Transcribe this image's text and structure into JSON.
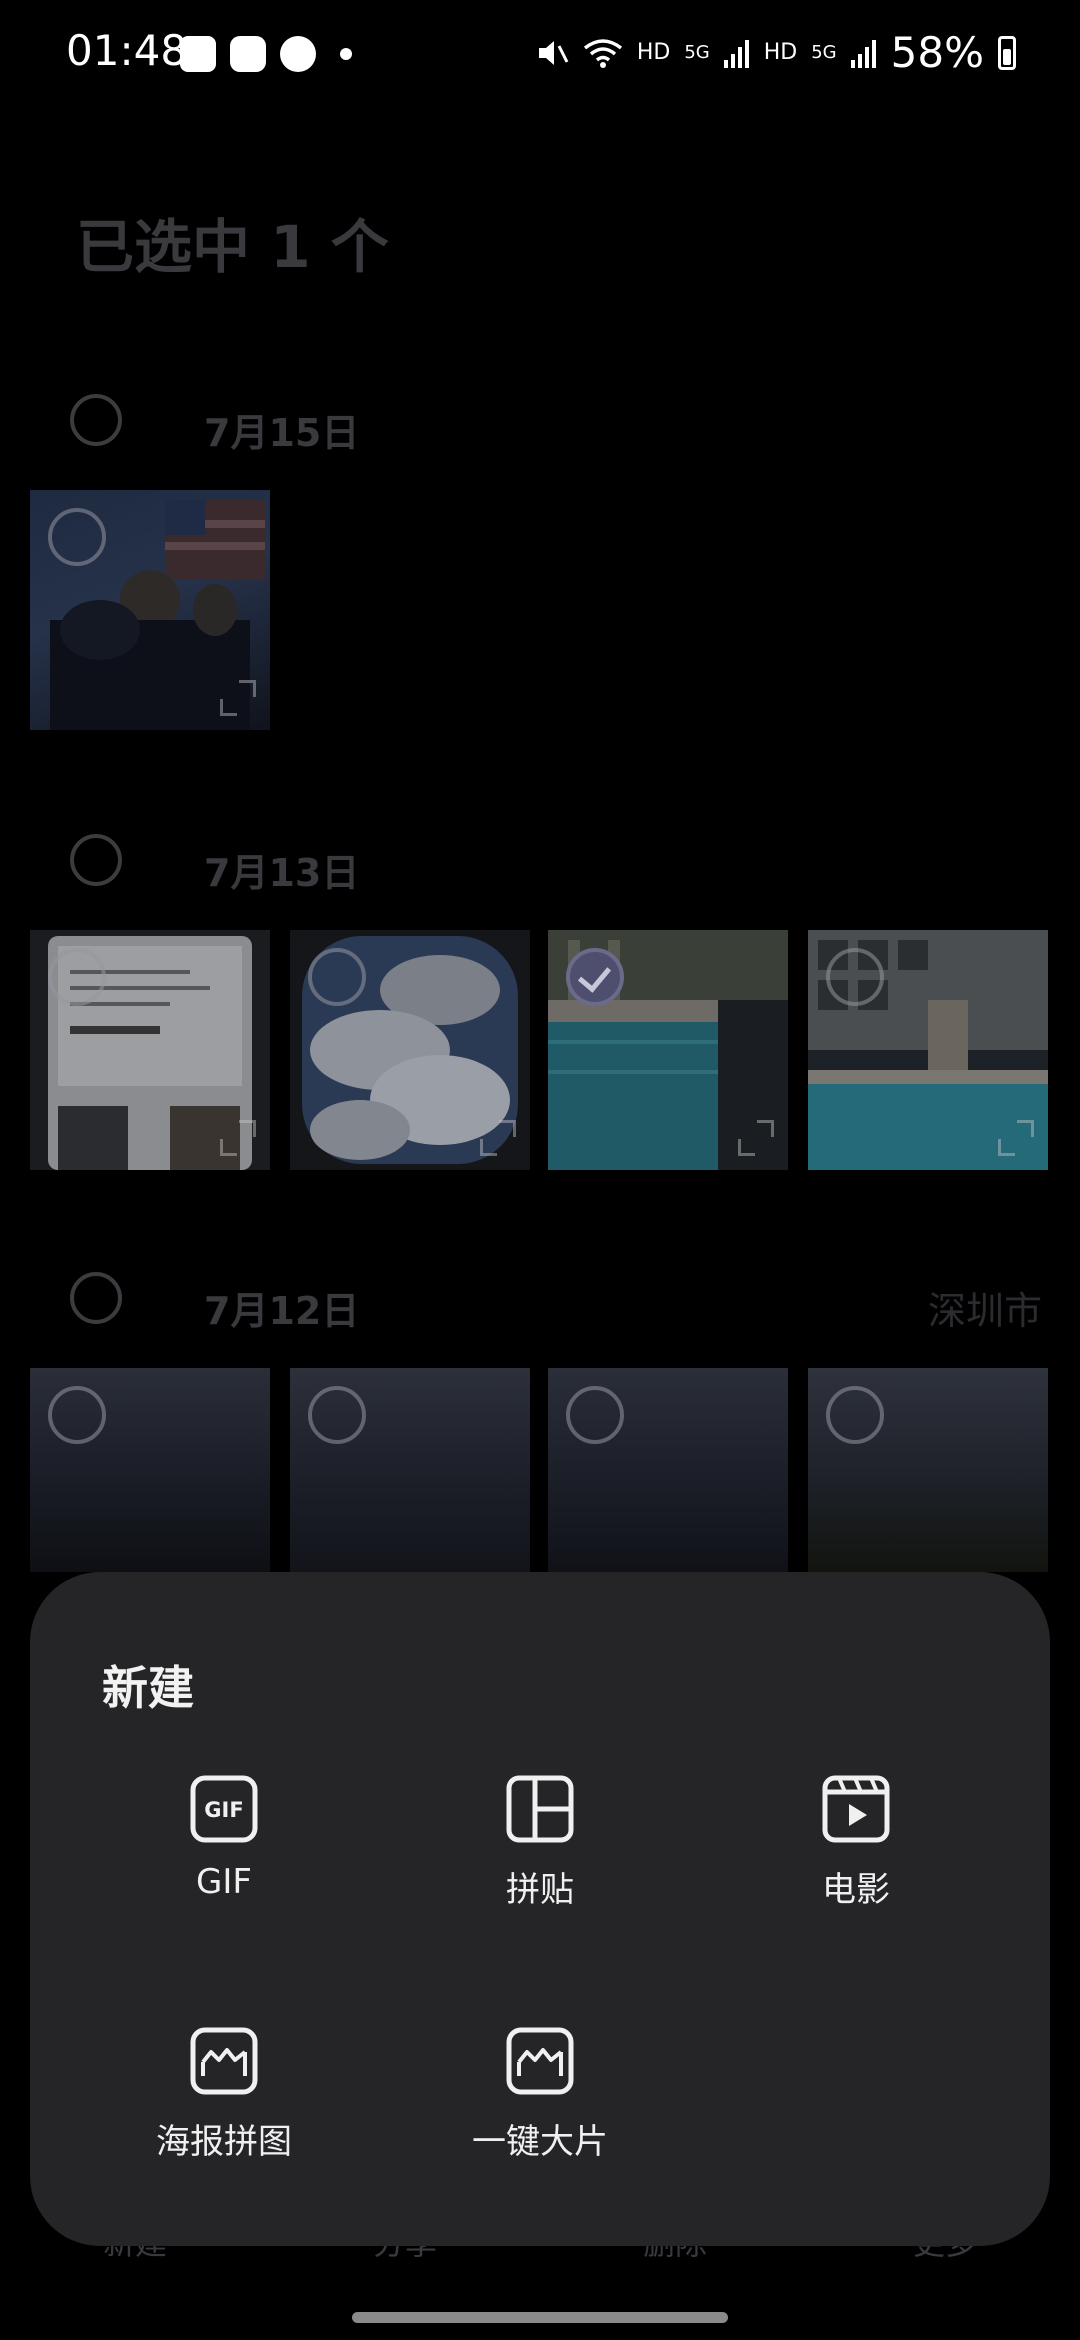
{
  "status_bar": {
    "time": "01:48",
    "hd1": "HD",
    "net1": "5G",
    "hd2": "HD",
    "net2": "5G",
    "battery": "58%"
  },
  "gallery": {
    "selected_title": "已选中 1 个",
    "days": [
      {
        "label": "7月15日",
        "location": ""
      },
      {
        "label": "7月13日",
        "location": ""
      },
      {
        "label": "7月12日",
        "location": "深圳市"
      }
    ]
  },
  "bottom_tabs": [
    "新建",
    "分享",
    "删除",
    "更多"
  ],
  "sheet": {
    "title": "新建",
    "options": [
      {
        "label": "GIF",
        "icon": "gif-icon",
        "icon_text": "GIF"
      },
      {
        "label": "拼贴",
        "icon": "collage-icon"
      },
      {
        "label": "电影",
        "icon": "movie-icon"
      },
      {
        "label": "海报拼图",
        "icon": "poster-collage-icon"
      },
      {
        "label": "一键大片",
        "icon": "one-click-film-icon"
      }
    ]
  },
  "colors": {
    "sheet_bg": "#252528",
    "background": "#000000",
    "dim_text": "#3a3a3e"
  }
}
